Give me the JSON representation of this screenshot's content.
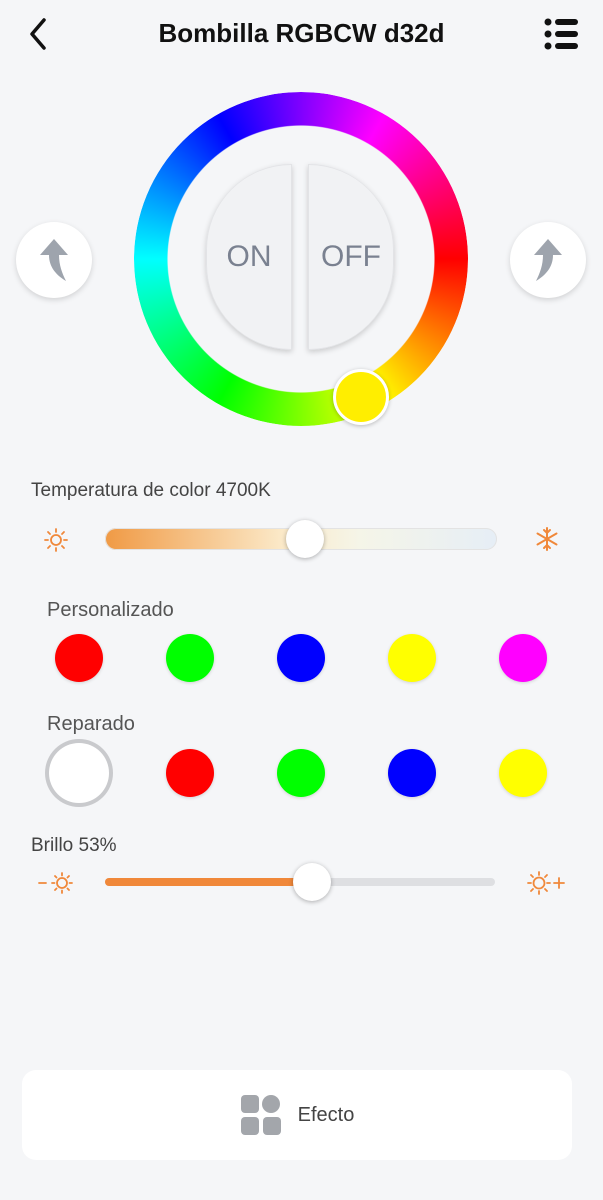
{
  "header": {
    "title": "Bombilla RGBCW d32d"
  },
  "power": {
    "on_label": "ON",
    "off_label": "OFF"
  },
  "wheel": {
    "selected_color": "#ffee00"
  },
  "temperature": {
    "label": "Temperatura de color 4700K",
    "level": 0.51
  },
  "custom": {
    "label": "Personalizado",
    "colors": [
      "#ff0000",
      "#00ff00",
      "#0000ff",
      "#ffff00",
      "#ff00ff"
    ]
  },
  "fixed": {
    "label": "Reparado",
    "colors": [
      "#ffffff",
      "#ff0000",
      "#00ff00",
      "#0000ff",
      "#ffff00"
    ],
    "selected_index": 0
  },
  "brightness": {
    "label": "Brillo 53%",
    "level": 0.53
  },
  "effect": {
    "label": "Efecto"
  },
  "colors": {
    "accent": "#f0883a"
  }
}
